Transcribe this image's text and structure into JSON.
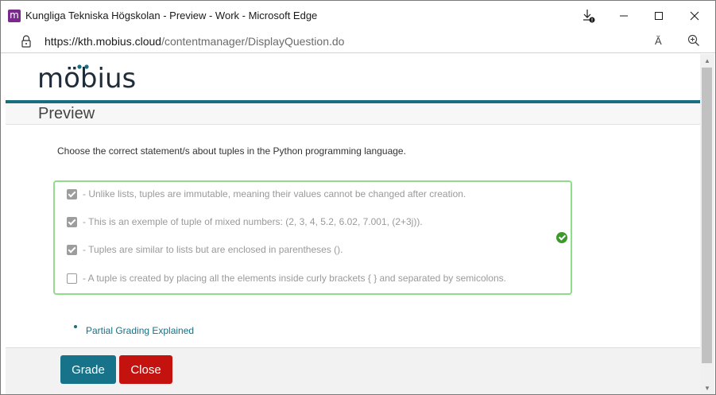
{
  "window": {
    "title": "Kungliga Tekniska Högskolan - Preview - Work - Microsoft Edge",
    "app_icon_letter": "m"
  },
  "addressbar": {
    "url_host": "https://kth.mobius.cloud",
    "url_path": "/contentmanager/DisplayQuestion.do",
    "read_aloud_label": "Ă"
  },
  "page": {
    "logo_text": "möbius",
    "preview_title": "Preview",
    "question": "Choose the correct statement/s about tuples in the Python programming language.",
    "options": [
      {
        "text": "- Unlike lists, tuples are immutable, meaning their values cannot be changed after creation.",
        "checked": true
      },
      {
        "text": "- This is an exemple of tuple of mixed numbers: (2, 3, 4,  5.2, 6.02, 7.001, (2+3j)).",
        "checked": true
      },
      {
        "text": "- Tuples are similar to lists but are enclosed in parentheses ().",
        "checked": true
      },
      {
        "text": "- A tuple is created by placing all the elements inside curly brackets { } and separated by semicolons.",
        "checked": false
      }
    ],
    "grading_link": "Partial Grading Explained"
  },
  "footer": {
    "grade_label": "Grade",
    "close_label": "Close"
  },
  "colors": {
    "accent": "#1a6e82",
    "grade_button": "#16738a",
    "close_button": "#c4120e",
    "correct_border": "#8fdc8a",
    "correct_icon": "#3b9a2a"
  }
}
